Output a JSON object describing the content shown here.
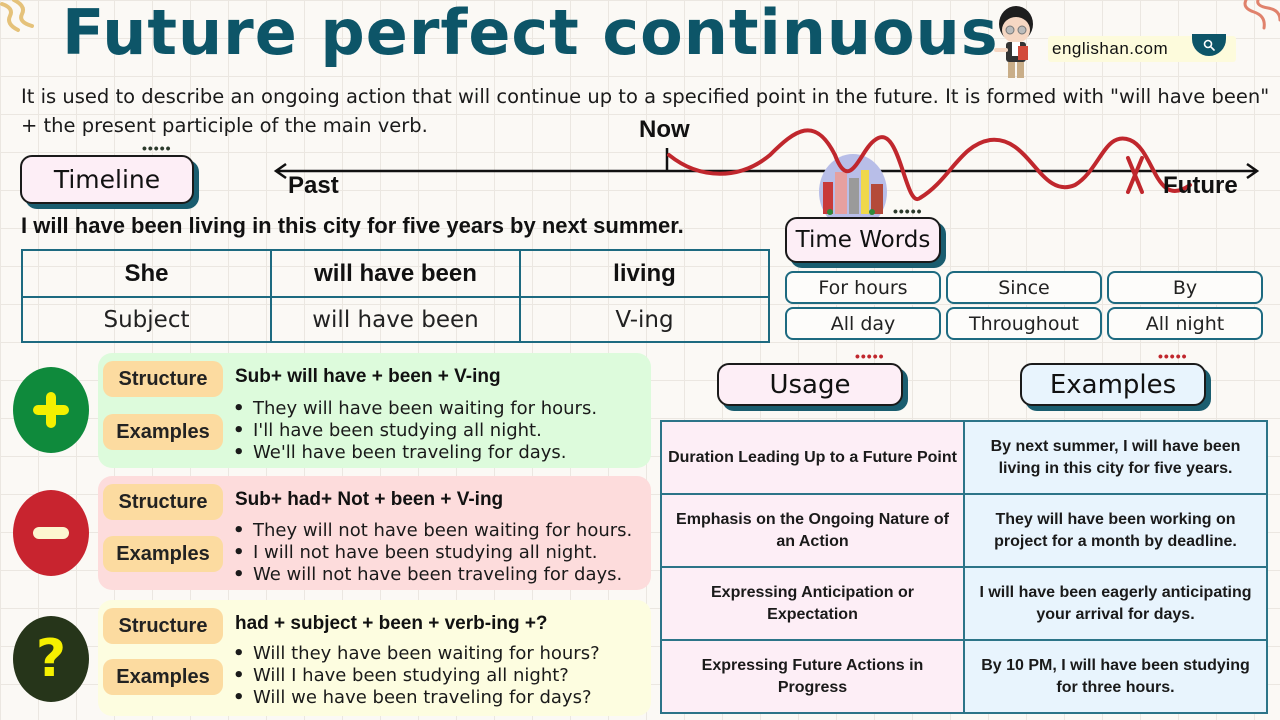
{
  "header": {
    "title": "Future perfect continuous",
    "site": "englishan.com",
    "search_icon": "search-icon",
    "mascot": "teacher-mascot"
  },
  "intro": "It is used to describe an ongoing action that will continue up to a specified point in the future. It is formed with \"will have been\" + the present participle of the main verb.",
  "timeline": {
    "section_label": "Timeline",
    "past_label": "Past",
    "now_label": "Now",
    "future_label": "Future",
    "end_marker": "X"
  },
  "example_sentence": "I will have been living in this city for five years by next summer.",
  "breakdown": {
    "headers": [
      "She",
      "will have been",
      "living"
    ],
    "roles": [
      "Subject",
      "will have been",
      "V-ing"
    ]
  },
  "time_words": {
    "section_label": "Time Words",
    "items": [
      "For hours",
      "Since",
      "By",
      "All day",
      "Throughout",
      "All night"
    ]
  },
  "forms": [
    {
      "type": "affirmative",
      "icon": "plus-icon",
      "structure_label": "Structure",
      "examples_label": "Examples",
      "structure": "Sub+ will have + been + V-ing",
      "examples": [
        "They will have been waiting for hours.",
        "I'll have been studying all night.",
        "We'll have been traveling for days."
      ],
      "colors": {
        "bg": "#ddfbdc",
        "icon_bg": "#0f8a3c",
        "icon_fg": "#f5f000"
      }
    },
    {
      "type": "negative",
      "icon": "minus-icon",
      "structure_label": "Structure",
      "examples_label": "Examples",
      "structure": "Sub+ had+ Not + been + V-ing",
      "examples": [
        "They will not have been waiting for hours.",
        "I will not have been studying all night.",
        "We will not have been traveling for days."
      ],
      "colors": {
        "bg": "#fddcdc",
        "icon_bg": "#c8242f",
        "icon_fg": "#fdf6d0"
      }
    },
    {
      "type": "interrogative",
      "icon": "question-icon",
      "structure_label": "Structure",
      "examples_label": "Examples",
      "structure": "had + subject + been + verb-ing +?",
      "examples": [
        "Will they have been waiting for hours?",
        "Will I have been studying all night?",
        "Will we have been traveling for days?"
      ],
      "colors": {
        "bg": "#fdfde0",
        "icon_bg": "#26351a",
        "icon_fg": "#f5f000"
      }
    }
  ],
  "usage": {
    "usage_label": "Usage",
    "examples_label": "Examples",
    "rows": [
      {
        "usage": "Duration Leading Up to a Future Point",
        "example": "By next summer, I will have been living in this city for five years."
      },
      {
        "usage": "Emphasis on the Ongoing Nature of an Action",
        "example": "They will have been working on project for a month by deadline."
      },
      {
        "usage": "Expressing Anticipation or Expectation",
        "example": "I will have been eagerly anticipating your arrival for days."
      },
      {
        "usage": "Expressing Future Actions in Progress",
        "example": "By 10 PM, I will have been studying for three hours."
      }
    ]
  },
  "colors": {
    "title": "#0d5568",
    "accent_red": "#c0272d",
    "table_border": "#1d6a80",
    "tag_bg": "#fcdba0",
    "timeline_pill_bg": "#fdeef6",
    "time_words_pill_bg": "#fdeef6",
    "usage_pill_bg": "#fdeef6",
    "examples_pill_bg": "#e8f4fd"
  }
}
